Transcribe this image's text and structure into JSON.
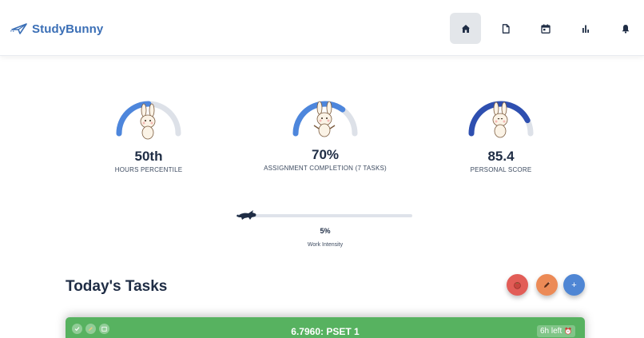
{
  "app": {
    "name": "StudyBunny"
  },
  "nav": {
    "items": [
      {
        "name": "home",
        "icon": "home-icon",
        "active": true
      },
      {
        "name": "documents",
        "icon": "document-icon",
        "active": false
      },
      {
        "name": "calendar",
        "icon": "calendar-icon",
        "active": false
      },
      {
        "name": "stats",
        "icon": "bar-chart-icon",
        "active": false
      },
      {
        "name": "notifications",
        "icon": "bell-icon",
        "active": false
      }
    ]
  },
  "stats": {
    "hours": {
      "value": "50th",
      "label": "HOURS PERCENTILE",
      "fill": 0.5
    },
    "assignments": {
      "value": "70%",
      "label": "ASSIGNMENT COMPLETION (7 TASKS)",
      "fill": 0.7
    },
    "score": {
      "value": "85.4",
      "label": "PERSONAL SCORE",
      "fill": 0.854
    }
  },
  "intensity": {
    "value": "5%",
    "label": "Work Intensity",
    "fill": 0.05
  },
  "tasks": {
    "title": "Today's Tasks",
    "actions": [
      {
        "name": "tomato-button",
        "icon": "tomato-icon"
      },
      {
        "name": "edit-button",
        "icon": "pencil-icon"
      },
      {
        "name": "add-button",
        "icon": "plus-icon",
        "label": "+"
      }
    ],
    "items": [
      {
        "title": "6.7960: PSET 1",
        "time_left": "6h left"
      }
    ]
  },
  "colors": {
    "brand": "#3b6fb6",
    "gauge_blue": "#4d86dc",
    "gauge_dark": "#2e4fb0",
    "gauge_track": "#dde1e8",
    "task_green": "#57b260"
  }
}
